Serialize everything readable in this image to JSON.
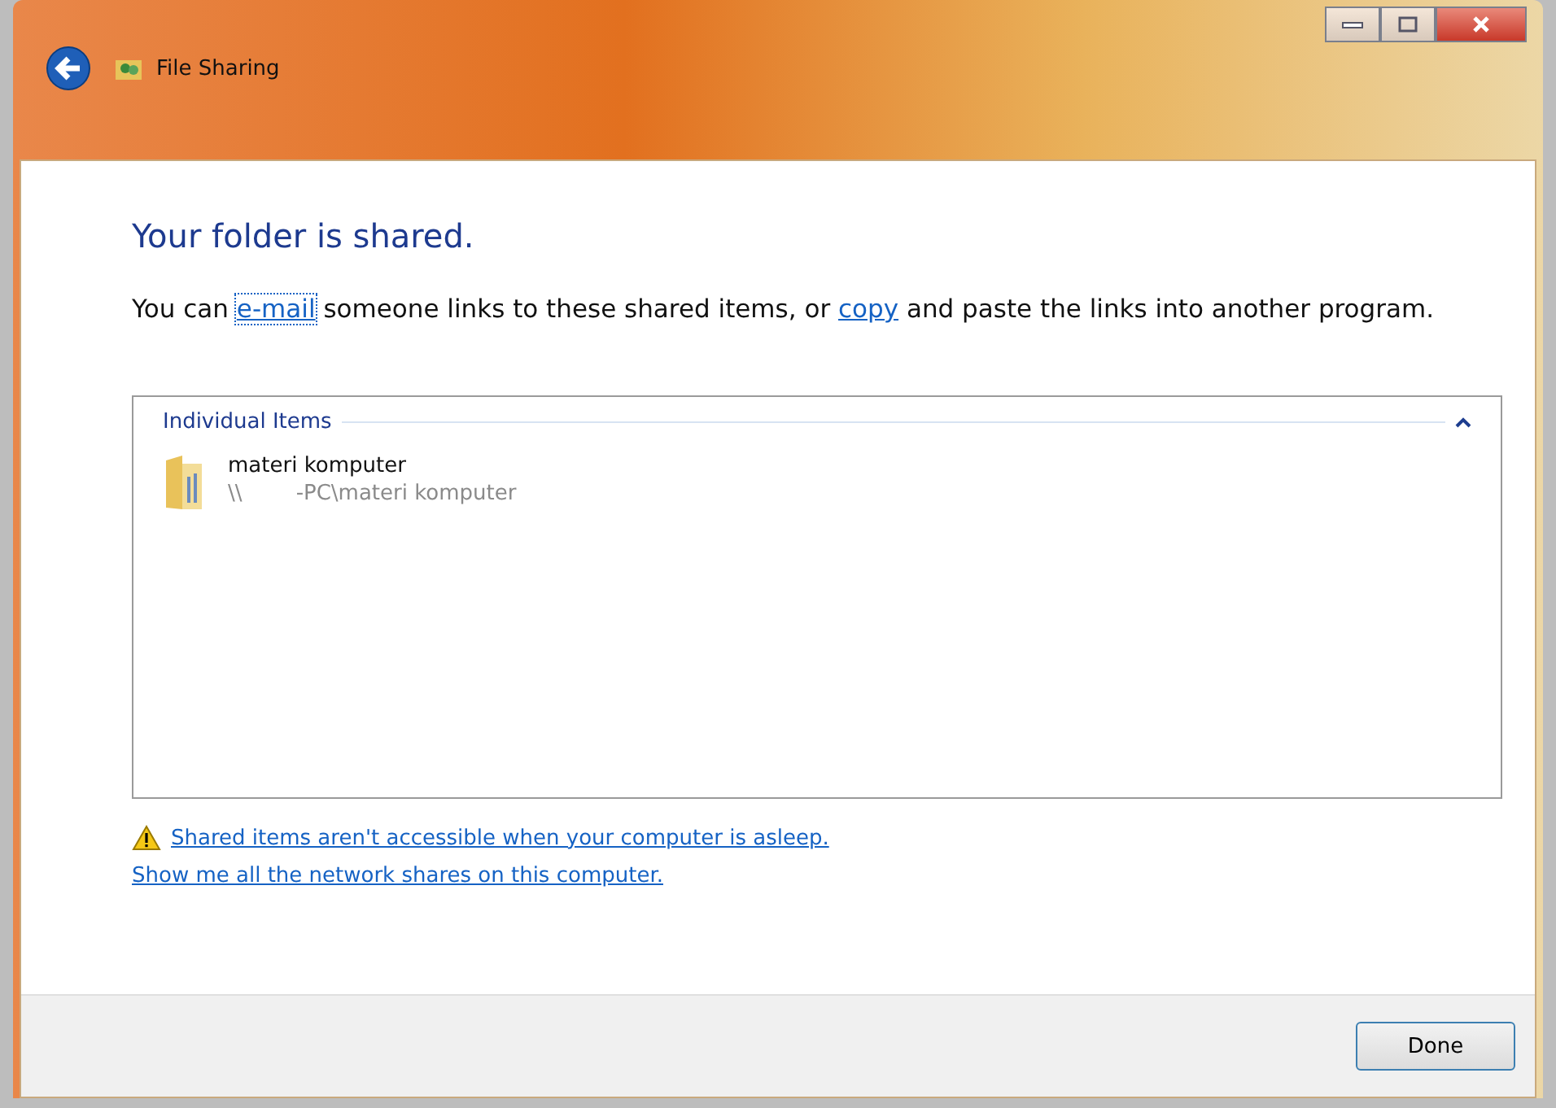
{
  "window": {
    "title": "File Sharing"
  },
  "heading": "Your folder is shared.",
  "message": {
    "before": "You can ",
    "link_1": {
      "text": "e-mail",
      "focused": true
    },
    "middle": " someone links to these shared items, or ",
    "link_2": {
      "text": "copy",
      "focused": false
    },
    "after": " and paste the links into another program."
  },
  "group": {
    "title": "Individual Items",
    "expanded": true,
    "items": [
      {
        "name": "materi komputer",
        "path": "\\\\        -PC\\materi komputer"
      }
    ]
  },
  "warning_link": "Shared items aren't accessible when your computer is asleep.",
  "shares_link": "Show me all the network shares on this computer.",
  "buttons": [
    "Done"
  ]
}
